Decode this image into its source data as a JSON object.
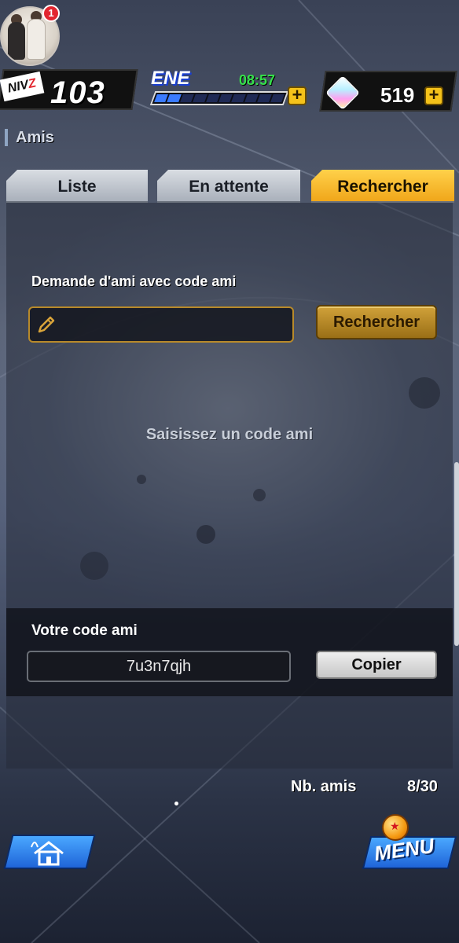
{
  "hud": {
    "notification_count": "1",
    "level_prefix": "NIV",
    "level_prefix_z": "Z",
    "level": "103",
    "energy_label": "ENE",
    "energy_timer": "08:57",
    "energy_fill": 0.2,
    "gems": "519",
    "plus": "+"
  },
  "section": {
    "title": "Amis"
  },
  "tabs": [
    {
      "label": "Liste"
    },
    {
      "label": "En attente"
    },
    {
      "label": "Rechercher",
      "active": true
    }
  ],
  "search": {
    "label": "Demande d'ami avec code ami",
    "input_value": "",
    "button_label": "Rechercher",
    "hint": "Saisissez un code ami"
  },
  "my_code": {
    "label": "Votre code ami",
    "value": "7u3n7qjh",
    "copy_label": "Copier"
  },
  "friends": {
    "label": "Nb. amis",
    "count": "8/30"
  },
  "bottom": {
    "menu_label": "MENU"
  },
  "colors": {
    "accent_tab": "#f0a61a",
    "button_gold": "#d1a23a",
    "nav_blue": "#1f64d8"
  }
}
